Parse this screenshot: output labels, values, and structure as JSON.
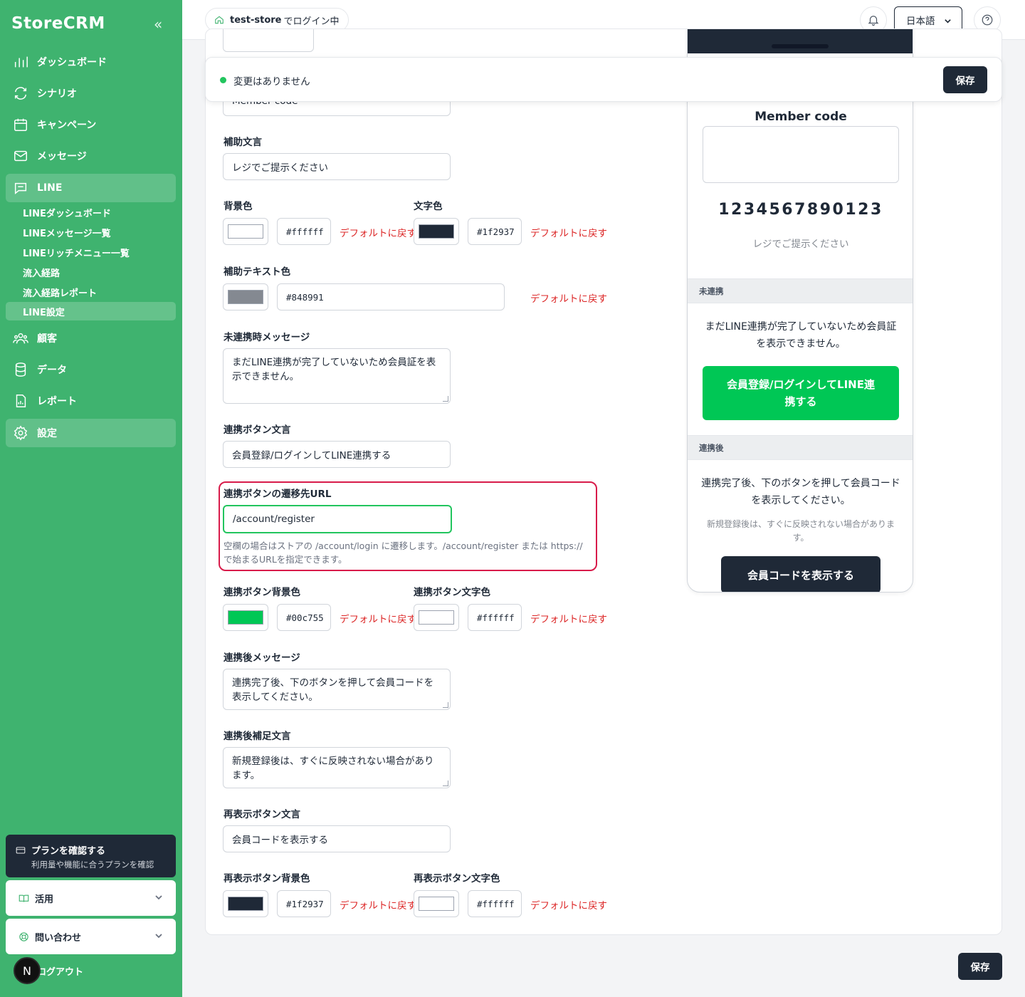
{
  "app": {
    "brand": "StoreCRM"
  },
  "sidebar": {
    "items": [
      {
        "label": "ダッシュボード",
        "icon": "bar-chart-icon"
      },
      {
        "label": "シナリオ",
        "icon": "refresh-icon"
      },
      {
        "label": "キャンペーン",
        "icon": "calendar-icon"
      },
      {
        "label": "メッセージ",
        "icon": "mail-icon"
      },
      {
        "label": "LINE",
        "icon": "chat-icon"
      },
      {
        "label": "顧客",
        "icon": "users-icon"
      },
      {
        "label": "データ",
        "icon": "database-icon"
      },
      {
        "label": "レポート",
        "icon": "report-icon"
      },
      {
        "label": "設定",
        "icon": "gear-icon"
      }
    ],
    "line_sub": [
      "LINEダッシュボード",
      "LINEメッセージ一覧",
      "LINEリッチメニュー一覧",
      "流入経路",
      "流入経路レポート",
      "LINE設定"
    ],
    "plan": {
      "title": "プランを確認する",
      "subtitle": "利用量や機能に合うプランを確認"
    },
    "accordions": [
      "活用",
      "問い合わせ"
    ],
    "avatar_initial": "N",
    "logout": "ログアウト"
  },
  "header": {
    "store_name": "test-store",
    "store_suffix": "でログイン中",
    "language": "日本語"
  },
  "sticky": {
    "status": "変更はありません",
    "save": "保存"
  },
  "form": {
    "cut_input_value": "Member code",
    "helper_text": {
      "label": "補助文言",
      "value": "レジでご提示ください"
    },
    "bg_color": {
      "label": "背景色",
      "value": "#ffffff"
    },
    "text_color": {
      "label": "文字色",
      "value": "#1f2937"
    },
    "helper_color": {
      "label": "補助テキスト色",
      "value": "#848991"
    },
    "unlinked_message": {
      "label": "未連携時メッセージ",
      "value": "まだLINE連携が完了していないため会員証を表示できません。"
    },
    "link_button_text": {
      "label": "連携ボタン文言",
      "value": "会員登録/ログインしてLINE連携する"
    },
    "link_button_url": {
      "label": "連携ボタンの遷移先URL",
      "value": "/account/register",
      "hint": "空欄の場合はストアの /account/login に遷移します。/account/register または https:// で始まるURLを指定できます。"
    },
    "link_button_bg": {
      "label": "連携ボタン背景色",
      "value": "#00c755"
    },
    "link_button_fg": {
      "label": "連携ボタン文字色",
      "value": "#ffffff"
    },
    "after_message": {
      "label": "連携後メッセージ",
      "value": "連携完了後、下のボタンを押して会員コードを表示してください。"
    },
    "after_note": {
      "label": "連携後補足文言",
      "value": "新規登録後は、すぐに反映されない場合があります。"
    },
    "reshow_text": {
      "label": "再表示ボタン文言",
      "value": "会員コードを表示する"
    },
    "reshow_bg": {
      "label": "再表示ボタン背景色",
      "value": "#1f2937"
    },
    "reshow_fg": {
      "label": "再表示ボタン文字色",
      "value": "#ffffff"
    },
    "reset_label": "デフォルトに戻す"
  },
  "preview": {
    "title": "Member code",
    "code": "1234567890123",
    "helper": "レジでご提示ください",
    "unlinked_section": "未連携",
    "unlinked_message": "まだLINE連携が完了していないため会員証を表示できません。",
    "link_button": "会員登録/ログインしてLINE連携する",
    "linked_section": "連携後",
    "linked_message": "連携完了後、下のボタンを押して会員コードを表示してください。",
    "linked_note": "新規登録後は、すぐに反映されない場合があります。",
    "show_button": "会員コードを表示する"
  },
  "footer": {
    "save": "保存"
  },
  "colors": {
    "sidebar": "#3fb36f",
    "accent_dark": "#1f2937",
    "line_green": "#00c755",
    "reset_red": "#dc2626",
    "highlight": "#d81b4a"
  }
}
